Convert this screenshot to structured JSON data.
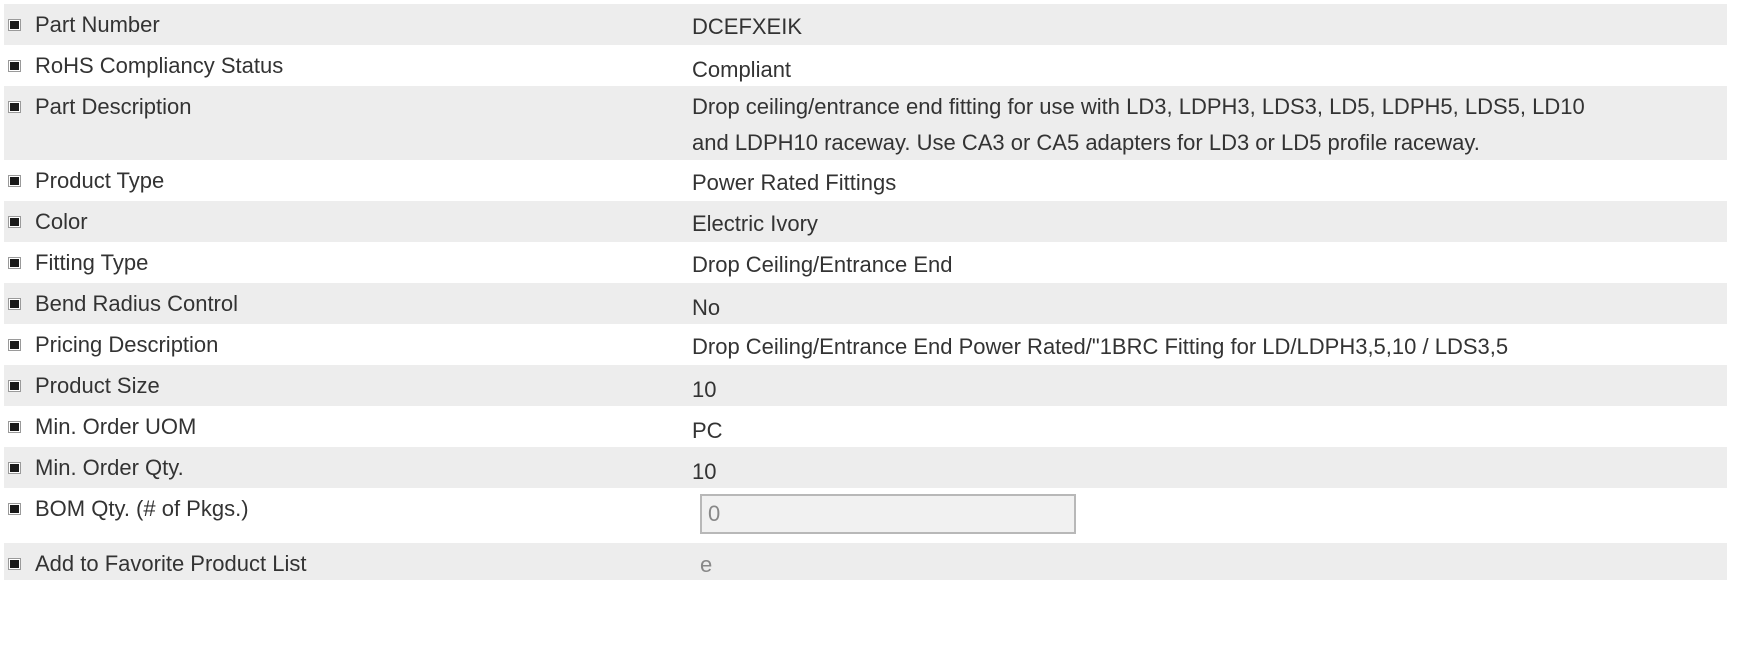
{
  "rows": [
    {
      "key": "part-number",
      "label": "Part Number",
      "value": "DCEFXEIK"
    },
    {
      "key": "rohs-status",
      "label": "RoHS Compliancy Status",
      "value": "Compliant"
    },
    {
      "key": "part-description",
      "label": "Part Description",
      "value_line1": "Drop ceiling/entrance end fitting for use with LD3, LDPH3, LDS3, LD5, LDPH5, LDS5, LD10",
      "value_line2": "and LDPH10 raceway. Use CA3 or CA5 adapters for LD3 or LD5 profile raceway."
    },
    {
      "key": "product-type",
      "label": "Product Type",
      "value": "Power Rated Fittings"
    },
    {
      "key": "color",
      "label": "Color",
      "value": "Electric Ivory"
    },
    {
      "key": "fitting-type",
      "label": "Fitting Type",
      "value": "Drop Ceiling/Entrance End"
    },
    {
      "key": "bend-radius-control",
      "label": "Bend Radius Control",
      "value": "No"
    },
    {
      "key": "pricing-description",
      "label": "Pricing Description",
      "value": "Drop Ceiling/Entrance End Power Rated/\"1BRC Fitting for LD/LDPH3,5,10 / LDS3,5"
    },
    {
      "key": "product-size",
      "label": "Product Size",
      "value": "10"
    },
    {
      "key": "min-order-uom",
      "label": "Min. Order UOM",
      "value": "PC"
    },
    {
      "key": "min-order-qty",
      "label": "Min. Order Qty.",
      "value": "10"
    },
    {
      "key": "bom-qty",
      "label": "BOM Qty. (# of Pkgs.)",
      "input_value": "0"
    },
    {
      "key": "add-favorite",
      "label": "Add to Favorite Product List",
      "value": "e"
    }
  ],
  "colors": {
    "row_alt": "#ededed",
    "text": "#333333",
    "input_border": "#b8b8b8"
  }
}
